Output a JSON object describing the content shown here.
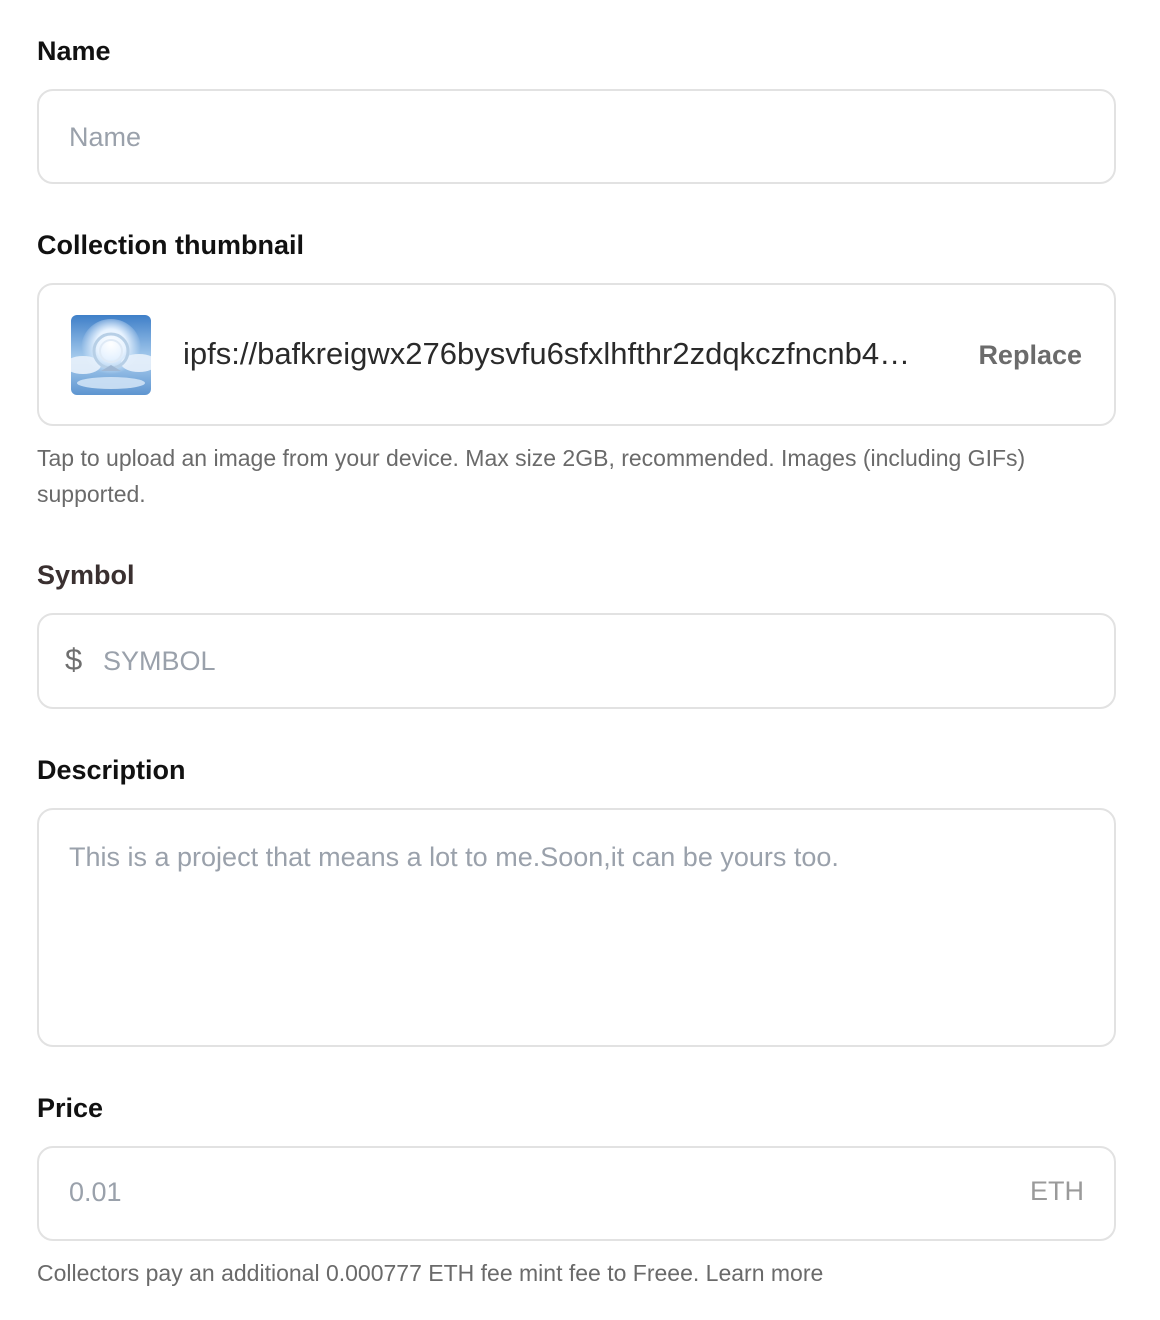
{
  "name_field": {
    "label": "Name",
    "placeholder": "Name",
    "value": ""
  },
  "thumbnail": {
    "label": "Collection thumbnail",
    "uri": "ipfs://bafkreigwx276bysvfu6sfxlhfthr2zdqkczfncnb4…",
    "replace_label": "Replace",
    "helper": "Tap to upload an image from your device. Max size 2GB, recommended. Images (including GIFs) supported."
  },
  "symbol_field": {
    "label": "Symbol",
    "prefix": "$",
    "placeholder": "SYMBOL",
    "value": ""
  },
  "description_field": {
    "label": "Description",
    "placeholder": "This is a project that means a lot to me.Soon,it can be yours too.",
    "value": ""
  },
  "price_field": {
    "label": "Price",
    "placeholder": "0.01",
    "value": "",
    "unit": "ETH",
    "helper": "Collectors pay an additional 0.000777 ETH fee mint fee to Freee. Learn more"
  },
  "colors": {
    "border": "#e2e2e2",
    "placeholder": "#9aa1ab",
    "helper_text": "#6a6a6a"
  },
  "icons": {
    "thumbnail_image": "crystal-orb-image"
  }
}
